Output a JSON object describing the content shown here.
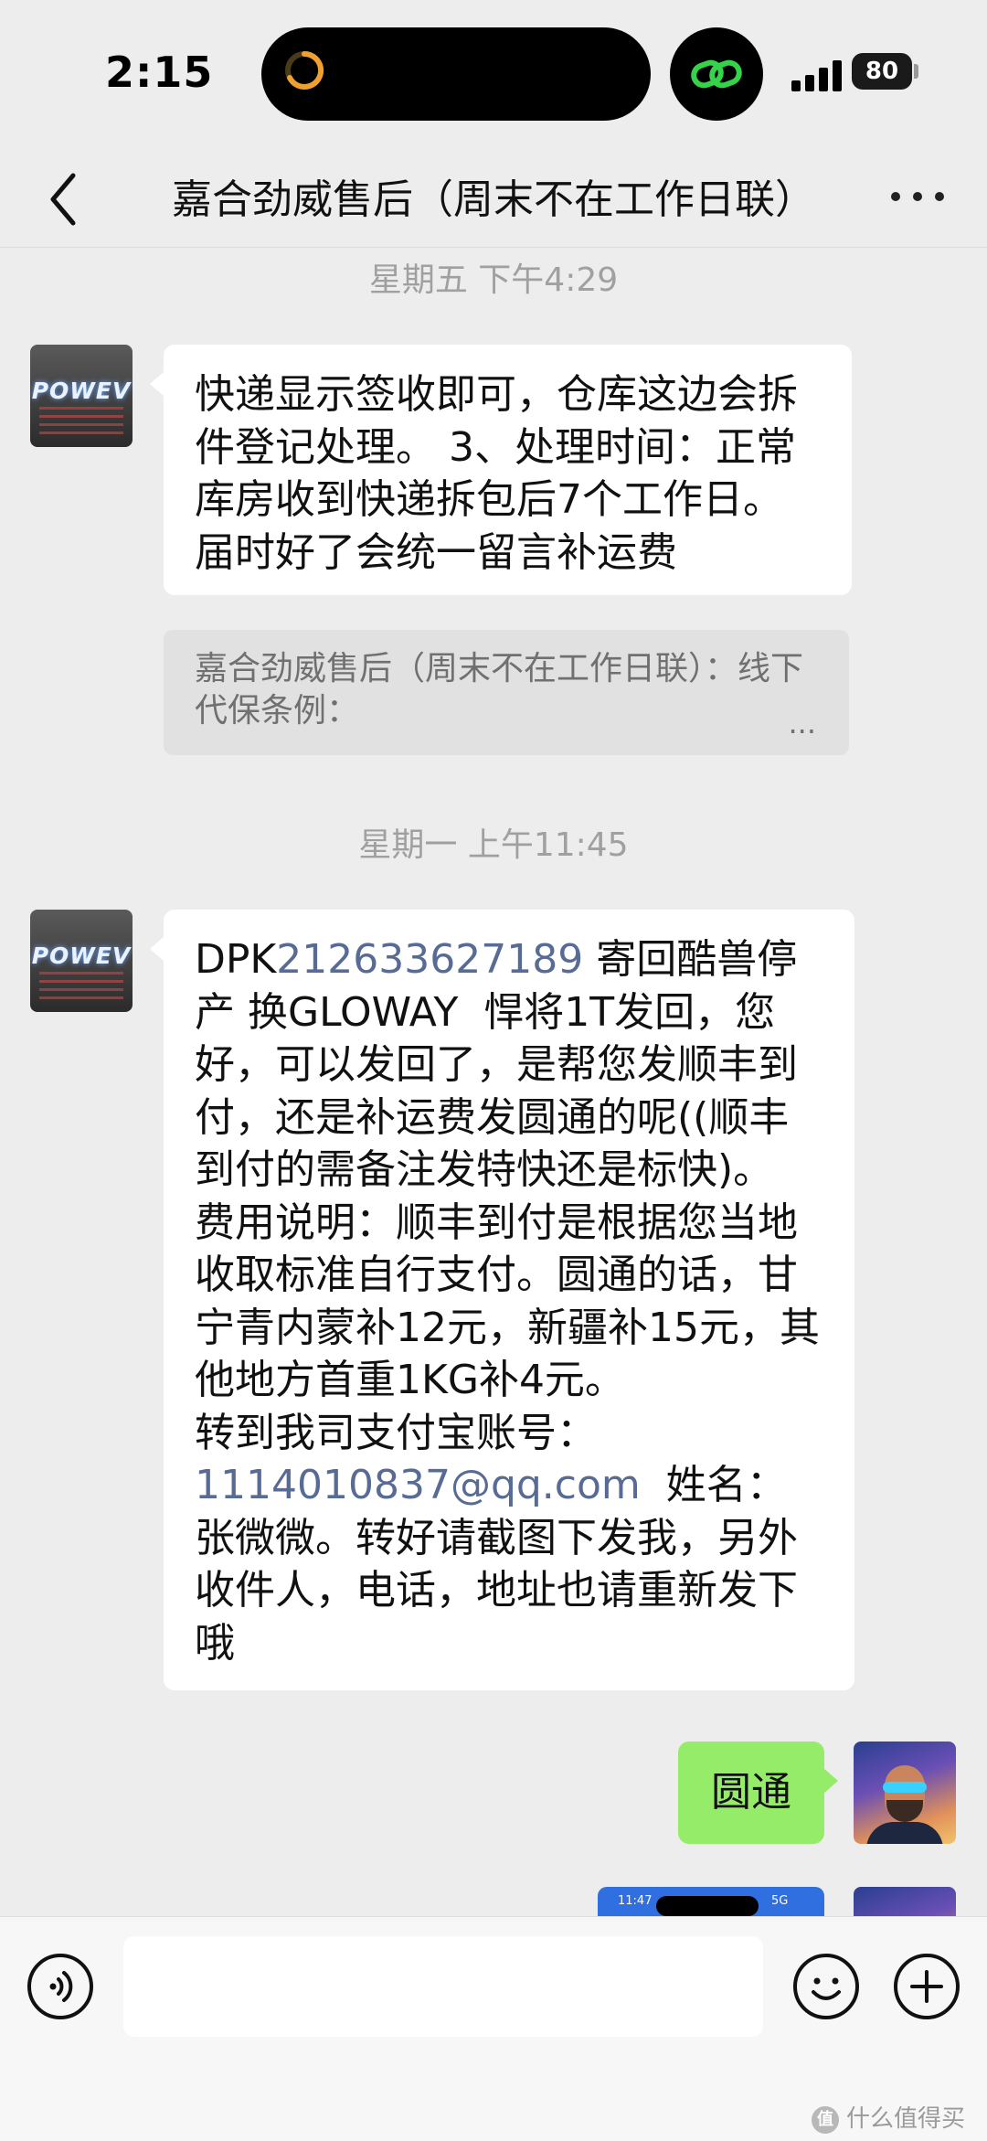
{
  "status_bar": {
    "time": "2:15",
    "battery": "80"
  },
  "header": {
    "title": "嘉合劲威售后（周末不在工作日联）"
  },
  "messages": {
    "ts1": "星期五 下午4:29",
    "msg1": "快递显示签收即可，仓库这边会拆件登记处理。 3、处理时间：正常库房收到快递拆包后7个工作日。届时好了会统一留言补运费",
    "quote1": "嘉合劲威售后（周末不在工作日联）：线下代保条例：",
    "quote1_more": "...",
    "ts2": "星期一 上午11:45",
    "msg2": {
      "prefix": "DPK",
      "order_no": "212633627189",
      "body1": " 寄回酷兽停产 换GLOWAY  悍将1T发回，您好，可以发回了，是帮您发顺丰到付，还是补运费发圆通的呢((顺丰到付的需备注发特快还是标快)。\n费用说明：顺丰到付是根据您当地收取标准自行支付。圆通的话，甘宁青内蒙补12元，新疆补15元，其他地方首重1KG补4元。\n转到我司支付宝账号：",
      "account": "1114010837@qq.com",
      "body2": "  姓名：张微微。转好请截图下发我，另外收件人，电话，地址也请重新发下哦"
    },
    "reply": "圆通",
    "thumb_time": "11:47",
    "thumb_status": "5G"
  },
  "avatar": {
    "brand": "POWEV"
  },
  "watermark": {
    "badge": "值",
    "text": "什么值得买"
  },
  "colors": {
    "link": "#576b95",
    "self_bubble": "#95ec69",
    "background": "#ededed"
  }
}
